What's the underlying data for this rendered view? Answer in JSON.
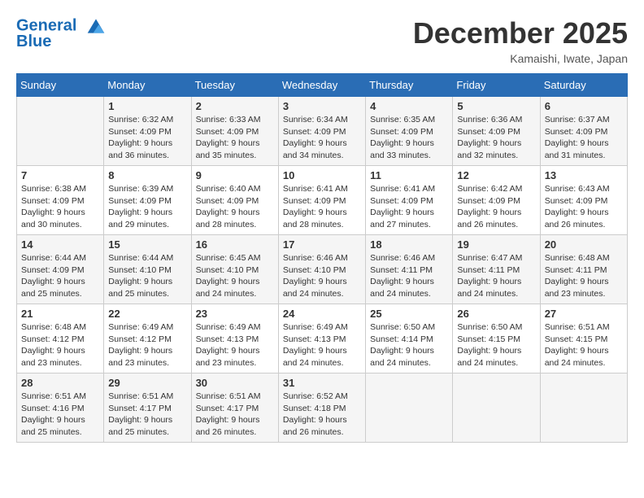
{
  "header": {
    "logo_line1": "General",
    "logo_line2": "Blue",
    "month_title": "December 2025",
    "location": "Kamaishi, Iwate, Japan"
  },
  "days_of_week": [
    "Sunday",
    "Monday",
    "Tuesday",
    "Wednesday",
    "Thursday",
    "Friday",
    "Saturday"
  ],
  "weeks": [
    [
      {
        "day": "",
        "info": ""
      },
      {
        "day": "1",
        "info": "Sunrise: 6:32 AM\nSunset: 4:09 PM\nDaylight: 9 hours\nand 36 minutes."
      },
      {
        "day": "2",
        "info": "Sunrise: 6:33 AM\nSunset: 4:09 PM\nDaylight: 9 hours\nand 35 minutes."
      },
      {
        "day": "3",
        "info": "Sunrise: 6:34 AM\nSunset: 4:09 PM\nDaylight: 9 hours\nand 34 minutes."
      },
      {
        "day": "4",
        "info": "Sunrise: 6:35 AM\nSunset: 4:09 PM\nDaylight: 9 hours\nand 33 minutes."
      },
      {
        "day": "5",
        "info": "Sunrise: 6:36 AM\nSunset: 4:09 PM\nDaylight: 9 hours\nand 32 minutes."
      },
      {
        "day": "6",
        "info": "Sunrise: 6:37 AM\nSunset: 4:09 PM\nDaylight: 9 hours\nand 31 minutes."
      }
    ],
    [
      {
        "day": "7",
        "info": "Sunrise: 6:38 AM\nSunset: 4:09 PM\nDaylight: 9 hours\nand 30 minutes."
      },
      {
        "day": "8",
        "info": "Sunrise: 6:39 AM\nSunset: 4:09 PM\nDaylight: 9 hours\nand 29 minutes."
      },
      {
        "day": "9",
        "info": "Sunrise: 6:40 AM\nSunset: 4:09 PM\nDaylight: 9 hours\nand 28 minutes."
      },
      {
        "day": "10",
        "info": "Sunrise: 6:41 AM\nSunset: 4:09 PM\nDaylight: 9 hours\nand 28 minutes."
      },
      {
        "day": "11",
        "info": "Sunrise: 6:41 AM\nSunset: 4:09 PM\nDaylight: 9 hours\nand 27 minutes."
      },
      {
        "day": "12",
        "info": "Sunrise: 6:42 AM\nSunset: 4:09 PM\nDaylight: 9 hours\nand 26 minutes."
      },
      {
        "day": "13",
        "info": "Sunrise: 6:43 AM\nSunset: 4:09 PM\nDaylight: 9 hours\nand 26 minutes."
      }
    ],
    [
      {
        "day": "14",
        "info": "Sunrise: 6:44 AM\nSunset: 4:09 PM\nDaylight: 9 hours\nand 25 minutes."
      },
      {
        "day": "15",
        "info": "Sunrise: 6:44 AM\nSunset: 4:10 PM\nDaylight: 9 hours\nand 25 minutes."
      },
      {
        "day": "16",
        "info": "Sunrise: 6:45 AM\nSunset: 4:10 PM\nDaylight: 9 hours\nand 24 minutes."
      },
      {
        "day": "17",
        "info": "Sunrise: 6:46 AM\nSunset: 4:10 PM\nDaylight: 9 hours\nand 24 minutes."
      },
      {
        "day": "18",
        "info": "Sunrise: 6:46 AM\nSunset: 4:11 PM\nDaylight: 9 hours\nand 24 minutes."
      },
      {
        "day": "19",
        "info": "Sunrise: 6:47 AM\nSunset: 4:11 PM\nDaylight: 9 hours\nand 24 minutes."
      },
      {
        "day": "20",
        "info": "Sunrise: 6:48 AM\nSunset: 4:11 PM\nDaylight: 9 hours\nand 23 minutes."
      }
    ],
    [
      {
        "day": "21",
        "info": "Sunrise: 6:48 AM\nSunset: 4:12 PM\nDaylight: 9 hours\nand 23 minutes."
      },
      {
        "day": "22",
        "info": "Sunrise: 6:49 AM\nSunset: 4:12 PM\nDaylight: 9 hours\nand 23 minutes."
      },
      {
        "day": "23",
        "info": "Sunrise: 6:49 AM\nSunset: 4:13 PM\nDaylight: 9 hours\nand 23 minutes."
      },
      {
        "day": "24",
        "info": "Sunrise: 6:49 AM\nSunset: 4:13 PM\nDaylight: 9 hours\nand 24 minutes."
      },
      {
        "day": "25",
        "info": "Sunrise: 6:50 AM\nSunset: 4:14 PM\nDaylight: 9 hours\nand 24 minutes."
      },
      {
        "day": "26",
        "info": "Sunrise: 6:50 AM\nSunset: 4:15 PM\nDaylight: 9 hours\nand 24 minutes."
      },
      {
        "day": "27",
        "info": "Sunrise: 6:51 AM\nSunset: 4:15 PM\nDaylight: 9 hours\nand 24 minutes."
      }
    ],
    [
      {
        "day": "28",
        "info": "Sunrise: 6:51 AM\nSunset: 4:16 PM\nDaylight: 9 hours\nand 25 minutes."
      },
      {
        "day": "29",
        "info": "Sunrise: 6:51 AM\nSunset: 4:17 PM\nDaylight: 9 hours\nand 25 minutes."
      },
      {
        "day": "30",
        "info": "Sunrise: 6:51 AM\nSunset: 4:17 PM\nDaylight: 9 hours\nand 26 minutes."
      },
      {
        "day": "31",
        "info": "Sunrise: 6:52 AM\nSunset: 4:18 PM\nDaylight: 9 hours\nand 26 minutes."
      },
      {
        "day": "",
        "info": ""
      },
      {
        "day": "",
        "info": ""
      },
      {
        "day": "",
        "info": ""
      }
    ]
  ]
}
